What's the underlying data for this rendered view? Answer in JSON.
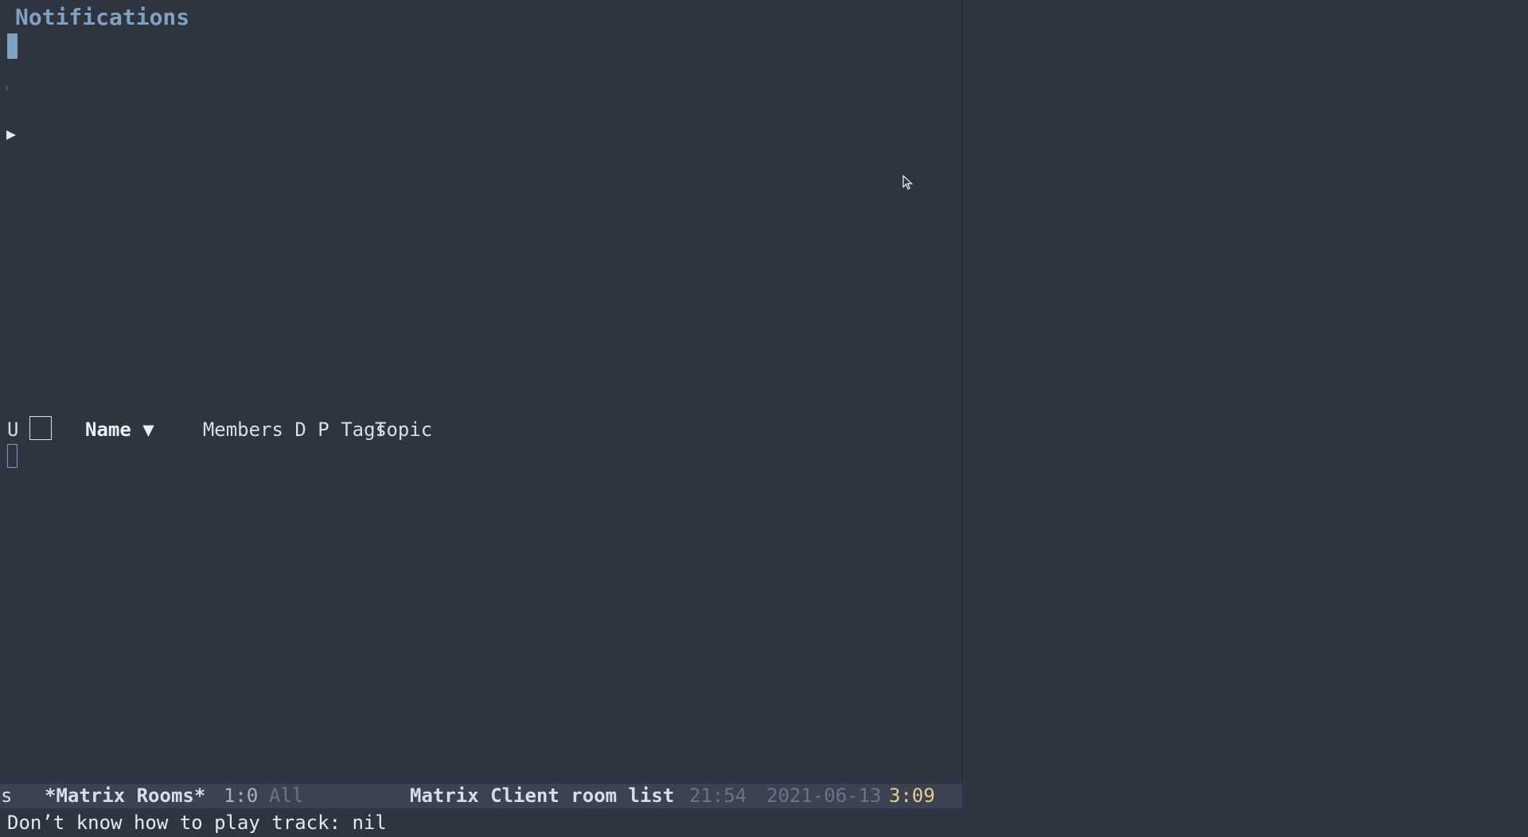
{
  "notifications": {
    "title": "Notifications",
    "play_icon": "play-triangle-icon",
    "play_glyph": "▶"
  },
  "room_list": {
    "columns": {
      "unread": "U",
      "name": "Name ▼",
      "topic": "Topic",
      "right_group": "Members D P Tags"
    }
  },
  "modeline": {
    "left_fragment": "s",
    "buffer_name": "*Matrix Rooms*",
    "position": "1:0",
    "scroll": "All",
    "mode_name": "Matrix Client room list",
    "time_a": "21:54",
    "date": "2021-06-13",
    "time_b": "3:09"
  },
  "echo_area": {
    "message": "Don’t know how to play track: nil"
  },
  "colors": {
    "background": "#2e3440",
    "modeline_bg": "#3b4252",
    "accent": "#81a1c1",
    "time_highlight": "#ebcb8b"
  }
}
